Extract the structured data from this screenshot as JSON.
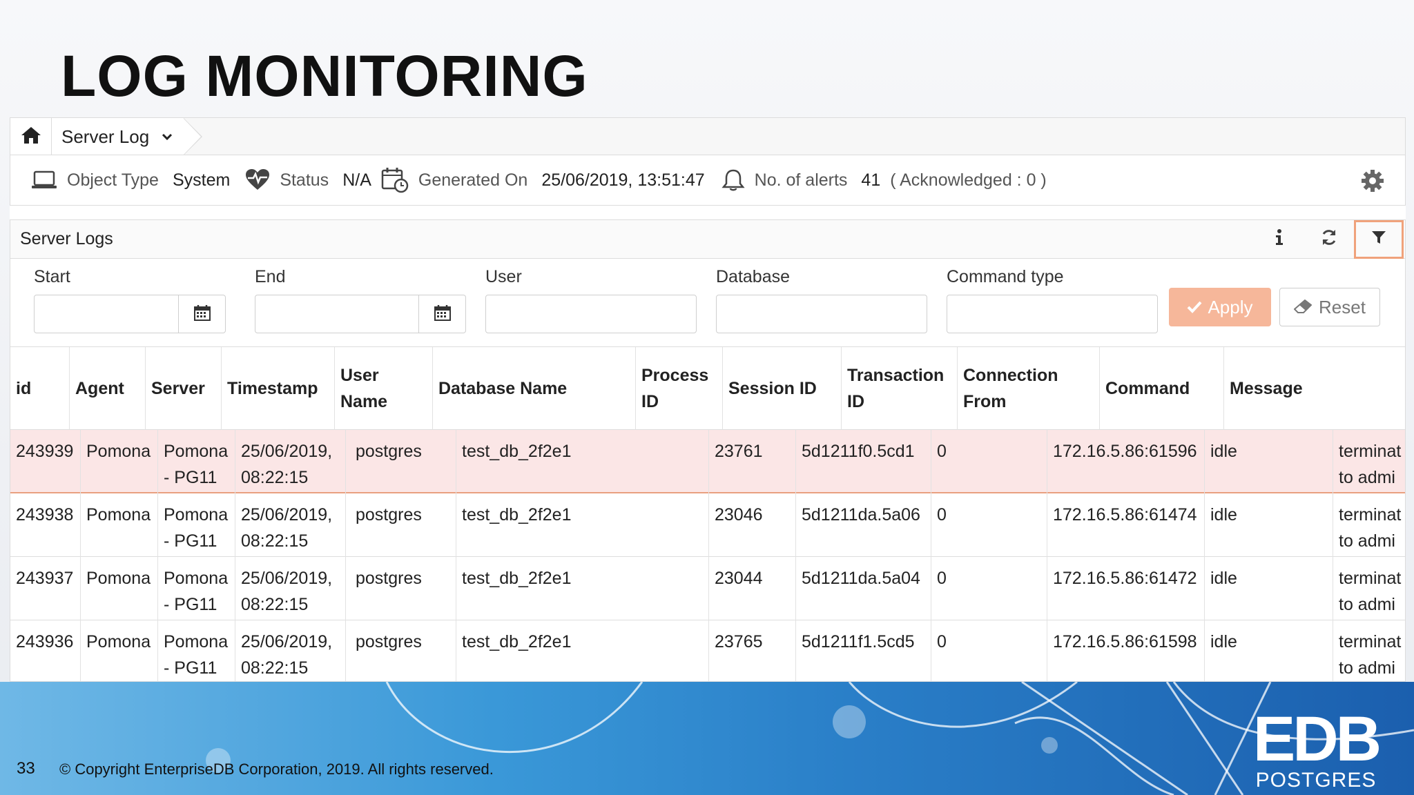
{
  "slide": {
    "title": "LOG MONITORING",
    "page_number": "33",
    "copyright": "© Copyright EnterpriseDB Corporation, 2019. All rights reserved.",
    "logo_main": "EDB",
    "logo_sub": "POSTGRES"
  },
  "tab": {
    "label": "Server Log"
  },
  "info": {
    "object_type_label": "Object Type",
    "object_type_value": "System",
    "status_label": "Status",
    "status_value": "N/A",
    "generated_label": "Generated On",
    "generated_value": "25/06/2019, 13:51:47",
    "alerts_label": "No. of alerts",
    "alerts_value": "41",
    "acknowledged": "( Acknowledged :  0 )"
  },
  "panel": {
    "title": "Server Logs"
  },
  "filters": {
    "start_label": "Start",
    "end_label": "End",
    "user_label": "User",
    "database_label": "Database",
    "command_label": "Command type",
    "apply_label": "Apply",
    "reset_label": "Reset"
  },
  "columns": {
    "id": "id",
    "agent": "Agent",
    "server": "Server",
    "timestamp": "Timestamp",
    "user_name_1": "User",
    "user_name_2": "Name",
    "database_name": "Database Name",
    "process_id_1": "Process",
    "process_id_2": "ID",
    "session_id": "Session ID",
    "transaction_id_1": "Transaction",
    "transaction_id_2": "ID",
    "connection_from_1": "Connection",
    "connection_from_2": "From",
    "command": "Command",
    "message": "Message"
  },
  "rows": [
    {
      "id": "243939",
      "agent": "Pomona",
      "server_1": "Pomona",
      "server_2": "- PG11",
      "ts_1": "25/06/2019,",
      "ts_2": "08:22:15",
      "user": "postgres",
      "db": "test_db_2f2e1",
      "pid": "23761",
      "session": "5d1211f0.5cd1",
      "txn": "0",
      "conn": "172.16.5.86:61596",
      "cmd": "idle",
      "msg_1": "terminat",
      "msg_2": "to admi"
    },
    {
      "id": "243938",
      "agent": "Pomona",
      "server_1": "Pomona",
      "server_2": "- PG11",
      "ts_1": "25/06/2019,",
      "ts_2": "08:22:15",
      "user": "postgres",
      "db": "test_db_2f2e1",
      "pid": "23046",
      "session": "5d1211da.5a06",
      "txn": "0",
      "conn": "172.16.5.86:61474",
      "cmd": "idle",
      "msg_1": "terminat",
      "msg_2": "to admi"
    },
    {
      "id": "243937",
      "agent": "Pomona",
      "server_1": "Pomona",
      "server_2": "- PG11",
      "ts_1": "25/06/2019,",
      "ts_2": "08:22:15",
      "user": "postgres",
      "db": "test_db_2f2e1",
      "pid": "23044",
      "session": "5d1211da.5a04",
      "txn": "0",
      "conn": "172.16.5.86:61472",
      "cmd": "idle",
      "msg_1": "terminat",
      "msg_2": "to admi"
    },
    {
      "id": "243936",
      "agent": "Pomona",
      "server_1": "Pomona",
      "server_2": "- PG11",
      "ts_1": "25/06/2019,",
      "ts_2": "08:22:15",
      "user": "postgres",
      "db": "test_db_2f2e1",
      "pid": "23765",
      "session": "5d1211f1.5cd5",
      "txn": "0",
      "conn": "172.16.5.86:61598",
      "cmd": "idle",
      "msg_1": "terminat",
      "msg_2": "to admi"
    }
  ]
}
